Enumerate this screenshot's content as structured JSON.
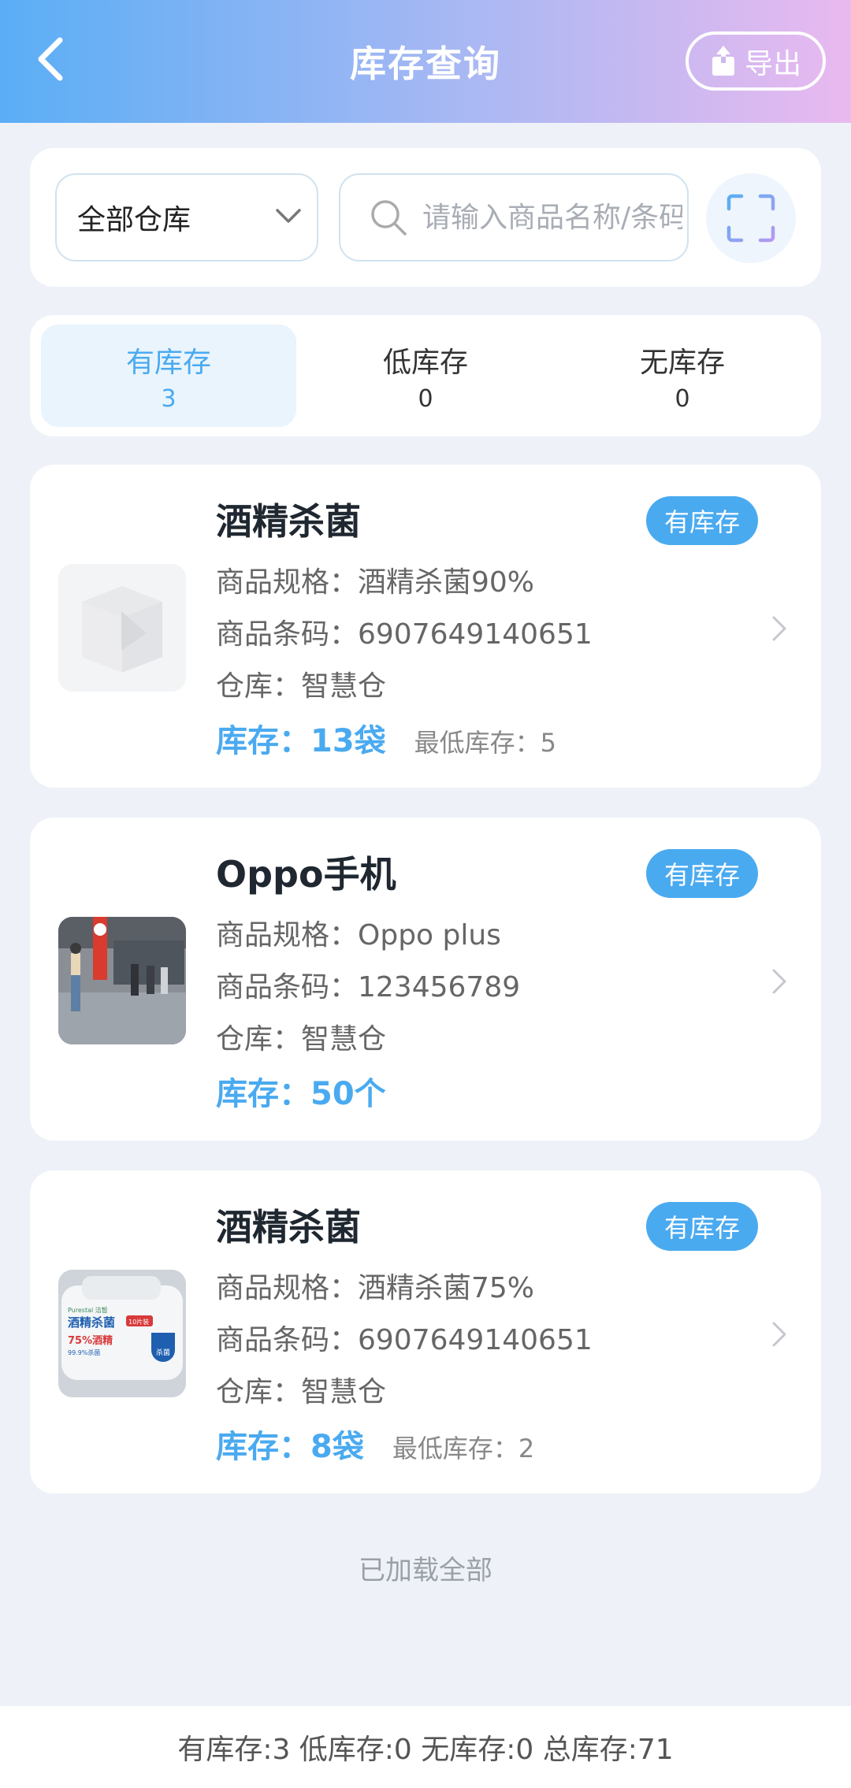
{
  "header": {
    "title": "库存查询",
    "export_label": "导出"
  },
  "filters": {
    "warehouse_selected": "全部仓库",
    "search_placeholder": "请输入商品名称/条码"
  },
  "tabs": [
    {
      "label": "有库存",
      "count": "3",
      "active": true
    },
    {
      "label": "低库存",
      "count": "0",
      "active": false
    },
    {
      "label": "无库存",
      "count": "0",
      "active": false
    }
  ],
  "products": [
    {
      "name": "酒精杀菌",
      "badge": "有库存",
      "spec": "商品规格：酒精杀菌90%",
      "barcode": "商品条码：6907649140651",
      "warehouse": "仓库：智慧仓",
      "stock_label": "库存：",
      "stock_value": "13袋",
      "min_stock": "最低库存：5"
    },
    {
      "name": "Oppo手机",
      "badge": "有库存",
      "spec": "商品规格：Oppo plus",
      "barcode": "商品条码：123456789",
      "warehouse": "仓库：智慧仓",
      "stock_label": "库存：",
      "stock_value": "50个",
      "min_stock": ""
    },
    {
      "name": "酒精杀菌",
      "badge": "有库存",
      "spec": "商品规格：酒精杀菌75%",
      "barcode": "商品条码：6907649140651",
      "warehouse": "仓库：智慧仓",
      "stock_label": "库存：",
      "stock_value": "8袋",
      "min_stock": "最低库存：2"
    }
  ],
  "thumb_text": {
    "brand": "Purestal 洁皙",
    "product": "酒精杀菌",
    "percent": "75%酒精",
    "kill": "99.9%杀菌",
    "tag": "杀菌",
    "corner": "10片装"
  },
  "list_end_text": "已加载全部",
  "footer_summary": "有库存:3 低库存:0 无库存:0 总库存:71",
  "colors": {
    "accent": "#4aaaf0",
    "header_gradient_start": "#5aaef5",
    "header_gradient_end": "#e9b9ef",
    "background": "#eef2f8"
  }
}
